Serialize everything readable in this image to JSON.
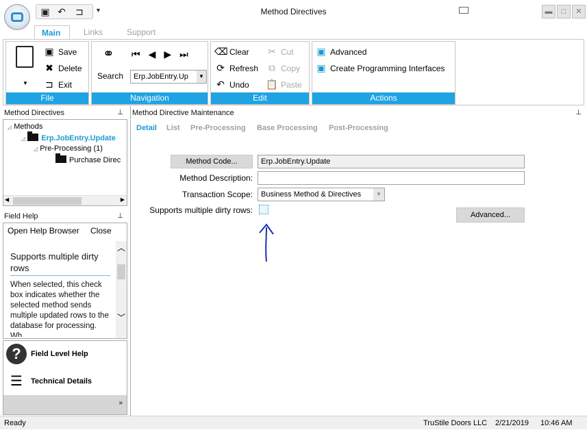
{
  "window": {
    "title": "Method Directives"
  },
  "ribbon": {
    "tabs": [
      "Main",
      "Links",
      "Support"
    ],
    "file": {
      "label": "File",
      "save": "Save",
      "delete": "Delete",
      "exit": "Exit"
    },
    "navigation": {
      "label": "Navigation",
      "search": "Search",
      "record_value": "Erp.JobEntry.Up"
    },
    "edit": {
      "label": "Edit",
      "clear": "Clear",
      "refresh": "Refresh",
      "undo": "Undo",
      "cut": "Cut",
      "copy": "Copy",
      "paste": "Paste"
    },
    "actions": {
      "label": "Actions",
      "advanced": "Advanced",
      "create_interfaces": "Create Programming Interfaces"
    }
  },
  "tree_pane": {
    "title": "Method Directives",
    "items": [
      "Methods",
      "Erp.JobEntry.Update",
      "Pre-Processing (1)",
      "Purchase Direc"
    ]
  },
  "help_pane": {
    "title": "Field Help",
    "open_browser": "Open Help Browser",
    "close": "Close",
    "heading": "Supports multiple dirty rows",
    "text": "When selected, this check box indicates whether the selected method sends multiple updated rows to the database for processing. Wh"
  },
  "bottom_pane": {
    "field_level_help": "Field Level Help",
    "technical_details": "Technical Details"
  },
  "main_pane": {
    "title": "Method Directive Maintenance",
    "tabs": [
      "Detail",
      "List",
      "Pre-Processing",
      "Base Processing",
      "Post-Processing"
    ],
    "form": {
      "method_code_button": "Method Code...",
      "method_code_value": "Erp.JobEntry.Update",
      "method_description_label": "Method Description:",
      "method_description_value": "",
      "transaction_scope_label": "Transaction Scope:",
      "transaction_scope_value": "Business Method & Directives",
      "supports_multiple_label": "Supports multiple dirty rows:",
      "advanced_button": "Advanced..."
    }
  },
  "status_bar": {
    "status": "Ready",
    "company": "TruStile Doors LLC",
    "date": "2/21/2019",
    "time": "10:46 AM"
  },
  "colors": {
    "accent": "#1d9ad6",
    "group_label_bg": "#1fa3e3",
    "annotation": "#1a2fb0"
  }
}
